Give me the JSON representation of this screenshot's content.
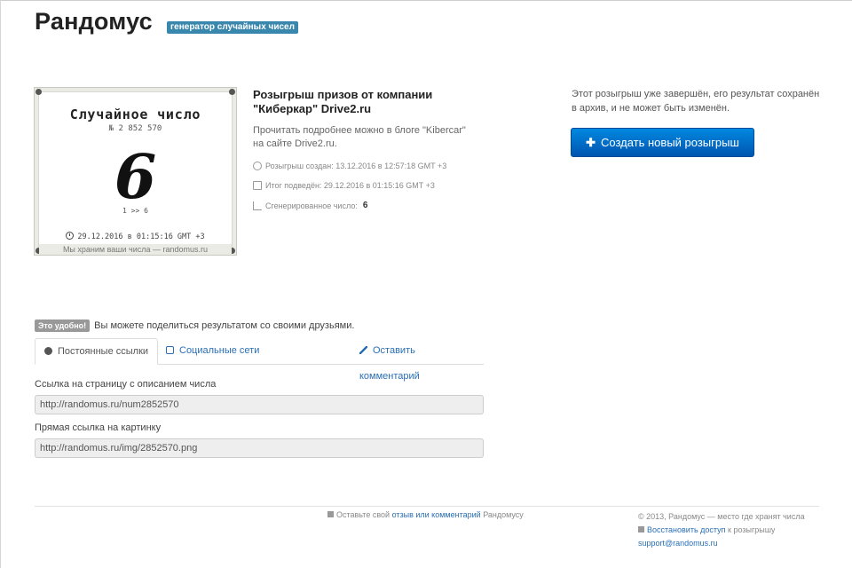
{
  "header": {
    "logo": "Рандомус",
    "tagline": "генератор случайных чисел"
  },
  "certificate": {
    "title": "Случайное число",
    "number": "№  2 852 570",
    "value": "6",
    "range": "1 >> 6",
    "date": "29.12.2016 в 01:15:16 GMT +3",
    "footer": "Мы храним ваши числа — randomus.ru"
  },
  "info": {
    "title": "Розыгрыш призов от компании \"Киберкар\" Drive2.ru",
    "description": "Прочитать подробнее можно в блоге \"Kibercar\" на сайте Drive2.ru.",
    "created": "Розыгрыш создан: 13.12.2016 в 12:57:18 GMT +3",
    "finished": "Итог подведён: 29.12.2016 в 01:15:16 GMT +3",
    "generated_label": "Сгенерированное число:",
    "generated_value": "6"
  },
  "right": {
    "note": "Этот розыгрыш уже завершён, его результат сохранён в архив, и не может быть изменён.",
    "create_button": "Создать новый розыгрыш"
  },
  "share": {
    "badge": "Это удобно!",
    "text": "Вы можете поделиться результатом со своими друзьями.",
    "tabs": [
      {
        "label": "Постоянные ссылки",
        "icon": "globe-icon"
      },
      {
        "label": "Социальные сети",
        "icon": "thumbs-up-icon"
      },
      {
        "label": "Оставить комментарий",
        "icon": "pencil-icon"
      }
    ],
    "page_link_label": "Ссылка на страницу с описанием числа",
    "page_link_value": "http://randomus.ru/num2852570",
    "image_link_label": "Прямая ссылка на картинку",
    "image_link_value": "http://randomus.ru/img/2852570.png"
  },
  "footer": {
    "feedback_prefix": "Оставьте свой",
    "feedback_link": "отзыв или комментарий",
    "feedback_suffix": "Рандомусу",
    "copyright": "© 2013, Рандомус — место где хранят числа",
    "restore_link": "Восстановить доступ",
    "restore_suffix": "к розыгрышу",
    "support_email": "support@randomus.ru"
  },
  "colors": {
    "accent": "#3a87ad",
    "button": "#0066cc",
    "link": "#2a6fb5"
  }
}
